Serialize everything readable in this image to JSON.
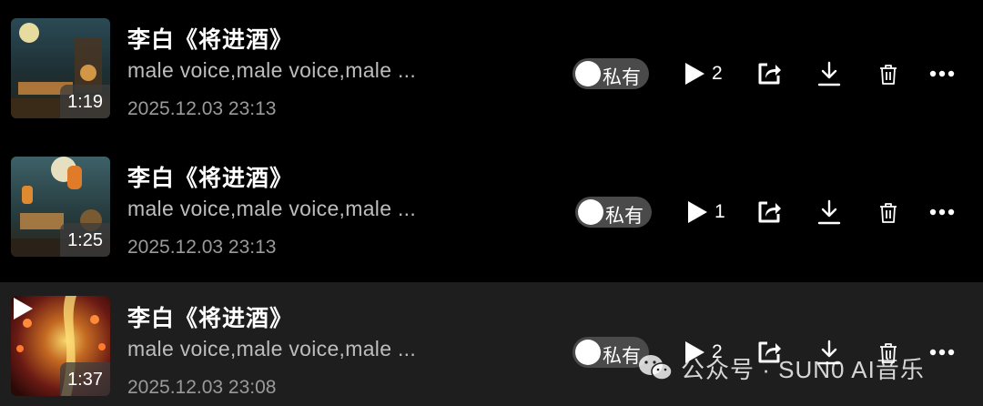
{
  "toggle_label": "私有",
  "tracks": [
    {
      "title": "李白《将进酒》",
      "description": "male voice,male voice,male ...",
      "date": "2025.12.03 23:13",
      "duration": "1:19",
      "play_count": "2",
      "is_private": true,
      "is_playing": false
    },
    {
      "title": "李白《将进酒》",
      "description": "male voice,male voice,male ...",
      "date": "2025.12.03 23:13",
      "duration": "1:25",
      "play_count": "1",
      "is_private": true,
      "is_playing": false
    },
    {
      "title": "李白《将进酒》",
      "description": "male voice,male voice,male ...",
      "date": "2025.12.03 23:08",
      "duration": "1:37",
      "play_count": "2",
      "is_private": true,
      "is_playing": true
    }
  ],
  "icons": {
    "play": "play-icon",
    "share": "share-icon",
    "download": "download-icon",
    "delete": "trash-icon",
    "more": "more-icon"
  },
  "watermark": {
    "text": "公众号 · SUN0 AI音乐"
  },
  "colors": {
    "background": "#000000",
    "selected_row": "#1e1e1e",
    "toggle_track": "#4a4a4a",
    "secondary_text": "#bdbdbd"
  }
}
